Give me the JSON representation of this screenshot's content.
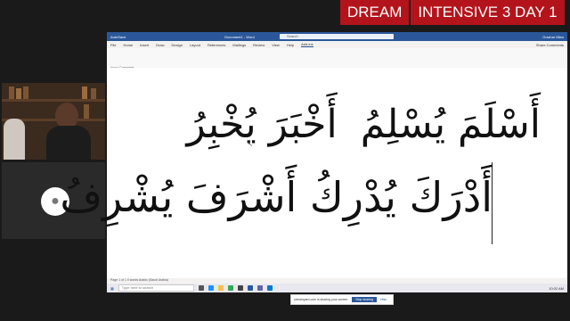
{
  "banner": {
    "left": "DREAM",
    "right": "INTENSIVE 3 DAY 1"
  },
  "word": {
    "app_left": "AutoSave",
    "doc_title": "Document1 - Word",
    "search_placeholder": "Search",
    "user": "Gowhar Mian",
    "tabs": [
      "File",
      "Home",
      "Insert",
      "Draw",
      "Design",
      "Layout",
      "References",
      "Mailings",
      "Review",
      "View",
      "Help",
      "Add-ins"
    ],
    "share": "Share   Comments",
    "ribbon_group": "Arcus Comments",
    "line1": "أَسْلَمَ يُسْلِمُ",
    "line1b": "أَخْبَرَ يُخْبِرُ",
    "line2": "أَدْرَكَ يُدْرِكُ  أَشْرَفَ يُشْرِفُ",
    "notify_text": "streamyard.com is sharing your screen.",
    "notify_stop": "Stop sharing",
    "notify_hide": "Hide",
    "status": "Page 1 of 1   0 words   Arabic (Saudi Arabia)",
    "taskbar_search": "Type here to search",
    "clock": "10:02 AM"
  },
  "colors": {
    "banner": "#b3141b",
    "word_blue": "#2b579a"
  }
}
